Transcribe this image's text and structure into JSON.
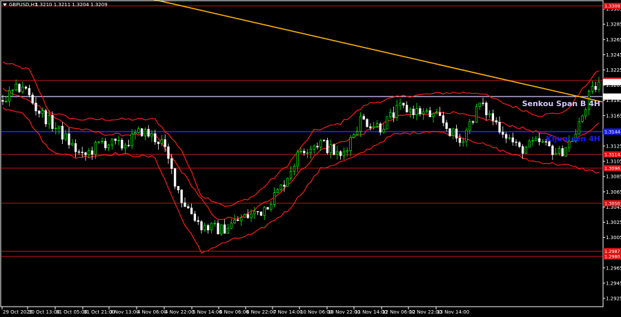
{
  "header": {
    "symbol": "GBPUSD,H1",
    "ohlc": "1.3210 1.3211 1.3204 1.3209"
  },
  "colors": {
    "background": "#000000",
    "frame": "#ffffff",
    "bull": "#00ff00",
    "bear": "#ffffff",
    "bands": "#ff1a1a",
    "support_resistance": "#c21818",
    "senkou": "#d8c8ff",
    "kijun": "#1a1aff",
    "trendline": "#ffb400",
    "red_tag": "#e01010",
    "current_tag": "#ffffff"
  },
  "chart_data": {
    "type": "candlestick",
    "symbol": "GBPUSD",
    "timeframe": "H1",
    "ylim": [
      1.2915,
      1.3315
    ],
    "y_ticks": [
      "1.3305",
      "1.3285",
      "1.3265",
      "1.3245",
      "1.3225",
      "1.3205",
      "1.3185",
      "1.3165",
      "1.3145",
      "1.3125",
      "1.3105",
      "1.3085",
      "1.3065",
      "1.3045",
      "1.3025",
      "1.3005",
      "1.2985",
      "1.2965",
      "1.2945",
      "1.2925"
    ],
    "x_ticks": [
      "29 Oct 2025",
      "30 Oct 13:00",
      "31 Oct 05:00",
      "31 Oct 21:00",
      "3 Nov 13:00",
      "4 Nov 06:00",
      "4 Nov 22:00",
      "5 Nov 14:00",
      "6 Nov 06:00",
      "6 Nov 22:00",
      "7 Nov 14:00",
      "10 Nov 06:00",
      "10 Nov 22:00",
      "11 Nov 14:00",
      "12 Nov 06:00",
      "12 Nov 22:00",
      "13 Nov 14:00"
    ],
    "anchors": [
      {
        "i": 0,
        "v": 1.3185
      },
      {
        "i": 6,
        "v": 1.3205
      },
      {
        "i": 10,
        "v": 1.3175
      },
      {
        "i": 18,
        "v": 1.314
      },
      {
        "i": 24,
        "v": 1.311
      },
      {
        "i": 30,
        "v": 1.313
      },
      {
        "i": 36,
        "v": 1.3125
      },
      {
        "i": 42,
        "v": 1.3145
      },
      {
        "i": 48,
        "v": 1.313
      },
      {
        "i": 54,
        "v": 1.3055
      },
      {
        "i": 60,
        "v": 1.302
      },
      {
        "i": 66,
        "v": 1.3015
      },
      {
        "i": 72,
        "v": 1.303
      },
      {
        "i": 78,
        "v": 1.304
      },
      {
        "i": 84,
        "v": 1.307
      },
      {
        "i": 90,
        "v": 1.312
      },
      {
        "i": 96,
        "v": 1.313
      },
      {
        "i": 102,
        "v": 1.311
      },
      {
        "i": 108,
        "v": 1.316
      },
      {
        "i": 114,
        "v": 1.315
      },
      {
        "i": 120,
        "v": 1.3175
      },
      {
        "i": 126,
        "v": 1.317
      },
      {
        "i": 132,
        "v": 1.316
      },
      {
        "i": 138,
        "v": 1.313
      },
      {
        "i": 144,
        "v": 1.318
      },
      {
        "i": 150,
        "v": 1.315
      },
      {
        "i": 156,
        "v": 1.312
      },
      {
        "i": 162,
        "v": 1.313
      },
      {
        "i": 168,
        "v": 1.3115
      },
      {
        "i": 173,
        "v": 1.314
      },
      {
        "i": 177,
        "v": 1.319
      },
      {
        "i": 180,
        "v": 1.3209
      }
    ],
    "bands": {
      "upper": [
        {
          "i": 0,
          "v": 1.3235
        },
        {
          "i": 8,
          "v": 1.3225
        },
        {
          "i": 14,
          "v": 1.317
        },
        {
          "i": 22,
          "v": 1.316
        },
        {
          "i": 34,
          "v": 1.316
        },
        {
          "i": 46,
          "v": 1.316
        },
        {
          "i": 54,
          "v": 1.312
        },
        {
          "i": 60,
          "v": 1.306
        },
        {
          "i": 68,
          "v": 1.3045
        },
        {
          "i": 76,
          "v": 1.306
        },
        {
          "i": 86,
          "v": 1.31
        },
        {
          "i": 94,
          "v": 1.3145
        },
        {
          "i": 102,
          "v": 1.3155
        },
        {
          "i": 110,
          "v": 1.318
        },
        {
          "i": 120,
          "v": 1.319
        },
        {
          "i": 134,
          "v": 1.3195
        },
        {
          "i": 144,
          "v": 1.3195
        },
        {
          "i": 152,
          "v": 1.318
        },
        {
          "i": 162,
          "v": 1.3165
        },
        {
          "i": 170,
          "v": 1.317
        },
        {
          "i": 176,
          "v": 1.3205
        },
        {
          "i": 180,
          "v": 1.3225
        }
      ],
      "middle": [
        {
          "i": 0,
          "v": 1.32
        },
        {
          "i": 10,
          "v": 1.318
        },
        {
          "i": 20,
          "v": 1.315
        },
        {
          "i": 32,
          "v": 1.314
        },
        {
          "i": 46,
          "v": 1.314
        },
        {
          "i": 56,
          "v": 1.308
        },
        {
          "i": 64,
          "v": 1.303
        },
        {
          "i": 72,
          "v": 1.303
        },
        {
          "i": 84,
          "v": 1.3065
        },
        {
          "i": 96,
          "v": 1.312
        },
        {
          "i": 108,
          "v": 1.314
        },
        {
          "i": 120,
          "v": 1.3165
        },
        {
          "i": 134,
          "v": 1.317
        },
        {
          "i": 146,
          "v": 1.316
        },
        {
          "i": 160,
          "v": 1.3145
        },
        {
          "i": 172,
          "v": 1.313
        },
        {
          "i": 180,
          "v": 1.3155
        }
      ],
      "lower": [
        {
          "i": 0,
          "v": 1.3175
        },
        {
          "i": 6,
          "v": 1.317
        },
        {
          "i": 14,
          "v": 1.312
        },
        {
          "i": 22,
          "v": 1.311
        },
        {
          "i": 34,
          "v": 1.3115
        },
        {
          "i": 46,
          "v": 1.311
        },
        {
          "i": 54,
          "v": 1.303
        },
        {
          "i": 60,
          "v": 1.2985
        },
        {
          "i": 68,
          "v": 1.3
        },
        {
          "i": 76,
          "v": 1.301
        },
        {
          "i": 86,
          "v": 1.304
        },
        {
          "i": 96,
          "v": 1.3095
        },
        {
          "i": 106,
          "v": 1.311
        },
        {
          "i": 118,
          "v": 1.314
        },
        {
          "i": 130,
          "v": 1.3145
        },
        {
          "i": 140,
          "v": 1.3135
        },
        {
          "i": 150,
          "v": 1.312
        },
        {
          "i": 160,
          "v": 1.3105
        },
        {
          "i": 170,
          "v": 1.31
        },
        {
          "i": 180,
          "v": 1.309
        }
      ]
    },
    "candle_count": 181,
    "levels": [
      {
        "name": "top",
        "value": 1.3309,
        "tag": "1.3309",
        "color": "#c21818"
      },
      {
        "name": "r1",
        "value": 1.3211,
        "tag": "1.3211",
        "color": "#c21818"
      },
      {
        "name": "senkou",
        "value": 1.319,
        "tag": "1.3190",
        "color": "#d8c8ff",
        "label": "Senkou Span B 4H"
      },
      {
        "name": "kijun",
        "value": 1.3144,
        "tag": "1.3144",
        "color": "#1a1aff",
        "label": "Kijun-sen 4H"
      },
      {
        "name": "s1",
        "value": 1.3114,
        "tag": "1.3114",
        "color": "#c21818"
      },
      {
        "name": "s2",
        "value": 1.3096,
        "tag": "1.3096",
        "color": "#c21818"
      },
      {
        "name": "s3",
        "value": 1.305,
        "tag": "1.3050",
        "color": "#c21818"
      },
      {
        "name": "s4",
        "value": 1.2987,
        "tag": "1.2987",
        "color": "#c21818"
      },
      {
        "name": "s5",
        "value": 1.298,
        "tag": "1.2980",
        "color": "#c21818"
      }
    ],
    "current_price": {
      "value": 1.3209,
      "tag": "1.3209"
    },
    "trendline": {
      "start": {
        "i": 38,
        "v": 1.3325
      },
      "end": {
        "i": 181,
        "v": 1.3183
      }
    }
  }
}
